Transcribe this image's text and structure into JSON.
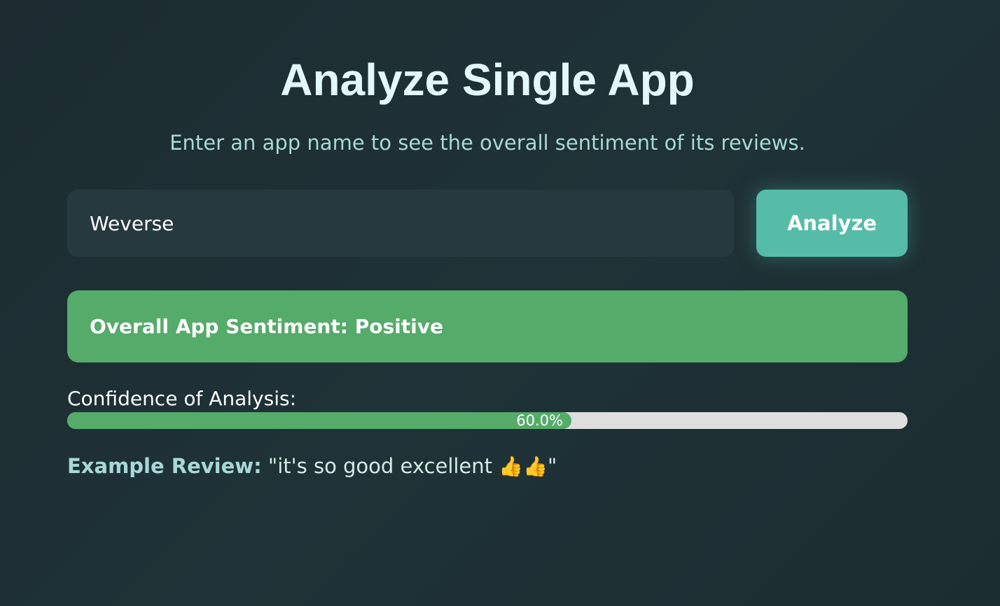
{
  "page": {
    "title": "Analyze Single App",
    "subtitle": "Enter an app name to see the overall sentiment of its reviews."
  },
  "search": {
    "value": "Weverse",
    "placeholder": "",
    "button_label": "Analyze"
  },
  "result": {
    "sentiment_label": "Overall App Sentiment: Positive",
    "confidence_label": "Confidence of Analysis:",
    "confidence_value": 0.6,
    "confidence_text": "60.0%",
    "example_label": "Example Review:",
    "example_quote_open": "\"it's so good excellent ",
    "example_quote_close": "\"",
    "example_icons": [
      "thumbs-up-icon",
      "thumbs-up-icon"
    ]
  },
  "colors": {
    "accent": "#56bca8",
    "positive": "#55ab69",
    "background": "#1f3237"
  }
}
